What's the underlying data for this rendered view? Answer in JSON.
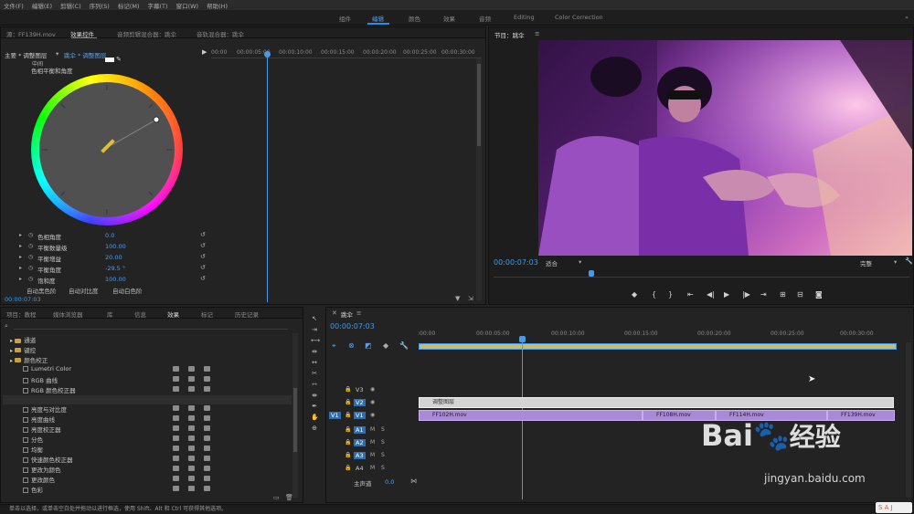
{
  "menu": [
    "文件(F)",
    "编辑(E)",
    "剪辑(C)",
    "序列(S)",
    "标记(M)",
    "字幕(T)",
    "窗口(W)",
    "帮助(H)"
  ],
  "workspaces": {
    "items": [
      "组件",
      "编辑",
      "颜色",
      "效果",
      "音频",
      "Editing",
      "Color Correction"
    ],
    "active": "编辑"
  },
  "source_panel": {
    "tabs": [
      "源：FF139H.mov",
      "效果控件",
      "音频剪辑混合器：跳伞",
      "音轨混合器：跳伞"
    ],
    "active_tab": "效果控件",
    "header_master": "主要 * 调整图层",
    "header_clip": "跳伞 * 调整图层",
    "ruler": [
      "00:00",
      "00:00:05:00",
      "00:00:10:00",
      "00:00:15:00",
      "00:00:20:00",
      "00:00:25:00",
      "00:00:30:00"
    ],
    "cutoff_label": "中间",
    "section_label": "色相平衡和角度",
    "properties": [
      {
        "name": "色相角度",
        "value": "0.0"
      },
      {
        "name": "平衡数量级",
        "value": "100.00"
      },
      {
        "name": "平衡增益",
        "value": "20.00"
      },
      {
        "name": "平衡角度",
        "value": "-29.5 °"
      },
      {
        "name": "饱和度",
        "value": "100.00"
      }
    ],
    "buttons": [
      "自动黑色阶",
      "自动对比度",
      "自动白色阶"
    ],
    "timecode": "00:00:07:03"
  },
  "program_panel": {
    "title": "节目：跳伞",
    "timecode": "00:00:07:03",
    "fit": "适合",
    "quality": "完整"
  },
  "project_panel": {
    "tabs": [
      "项目：教程",
      "媒体浏览器",
      "库",
      "信息",
      "效果",
      "标记",
      "历史记录"
    ],
    "active_tab": "效果",
    "tree": [
      {
        "label": "通道",
        "indent": 1,
        "folder": true
      },
      {
        "label": "键控",
        "indent": 1,
        "folder": true
      },
      {
        "label": "颜色校正",
        "indent": 1,
        "folder": true
      },
      {
        "label": "Lumetri Color",
        "indent": 2
      },
      {
        "label": "RGB 曲线",
        "indent": 2
      },
      {
        "label": "RGB 颜色校正器",
        "indent": 2
      },
      {
        "label": "三向颜色校正器",
        "indent": 2
      },
      {
        "label": "亮度与对比度",
        "indent": 2
      },
      {
        "label": "亮度曲线",
        "indent": 2
      },
      {
        "label": "亮度校正器",
        "indent": 2
      },
      {
        "label": "分色",
        "indent": 2
      },
      {
        "label": "均衡",
        "indent": 2
      },
      {
        "label": "快速颜色校正器",
        "indent": 2
      },
      {
        "label": "更改为颜色",
        "indent": 2
      },
      {
        "label": "更改颜色",
        "indent": 2
      },
      {
        "label": "色彩",
        "indent": 2
      }
    ]
  },
  "timeline": {
    "title": "跳伞",
    "timecode": "00:00:07:03",
    "ruler": [
      ":00:00",
      "00:00:05:00",
      "00:00:10:00",
      "00:00:15:00",
      "00:00:20:00",
      "00:00:25:00",
      "00:00:30:00"
    ],
    "tracks": {
      "video": [
        "V3",
        "V2",
        "V1"
      ],
      "audio": [
        "A1",
        "A2",
        "A3",
        "A4"
      ],
      "master": "主声道",
      "master_value": "0.0",
      "src_v": "V1"
    },
    "clips_v2": "调整图层",
    "clips_v1": [
      "FF102H.mov",
      "FF108H.mov",
      "FF114H.mov",
      "FF139H.mov"
    ]
  },
  "status": "单击以选择，或单击空白处并拖动以进行框选，使用 Shift、Alt 和 Ctrl 可获得其他选项。",
  "watermark": {
    "brand": "Bai",
    "brand2": "经验",
    "url": "jingyan.baidu.com"
  },
  "colors": {
    "accent": "#2d8ceb",
    "clip": "#a98ad6",
    "adjust": "#d4d4d4",
    "bg": "#232323"
  }
}
